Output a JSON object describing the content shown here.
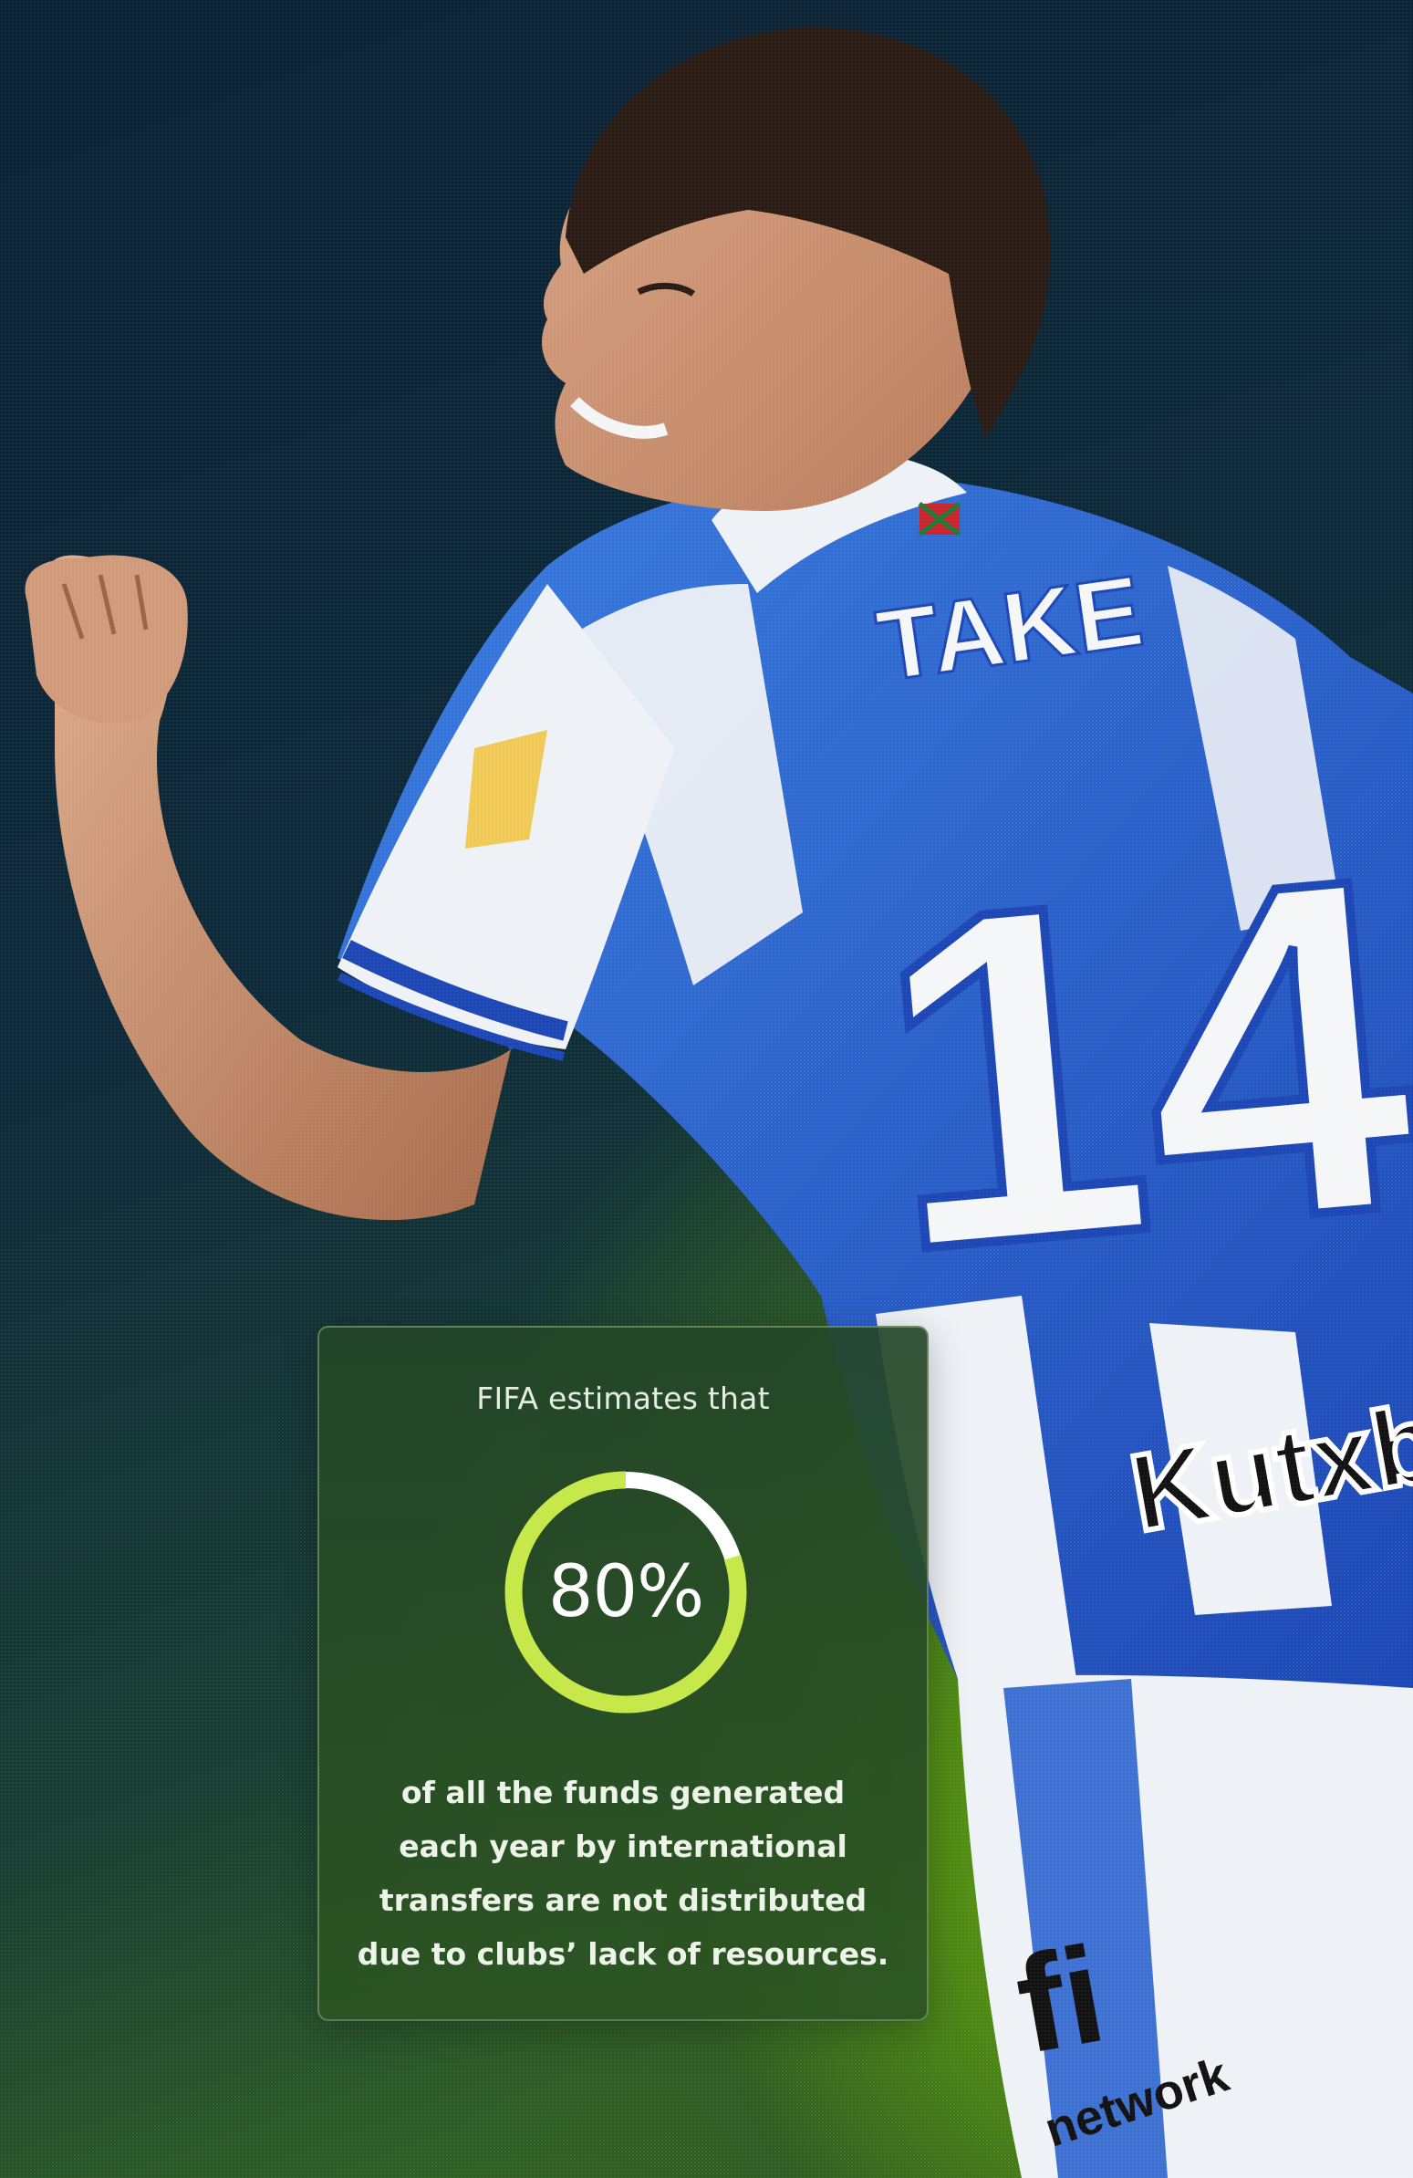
{
  "photo": {
    "jersey_name": "TAKE",
    "jersey_number": "14",
    "sponsor_text": "Kutxb",
    "shorts_text": "network",
    "shorts_logo": "fi"
  },
  "stat_card": {
    "intro": "FIFA estimates that",
    "percent_label": "80%",
    "percent_value": 80,
    "body_lines": [
      "of all the funds generated",
      "each year by international",
      "transfers are not distributed",
      "due to clubs’ lack of resources."
    ]
  },
  "colors": {
    "accent": "#c6e84a",
    "ring_track": "#ffffff",
    "jersey_blue": "#2b63cf",
    "jersey_white": "#f2f4f6"
  }
}
